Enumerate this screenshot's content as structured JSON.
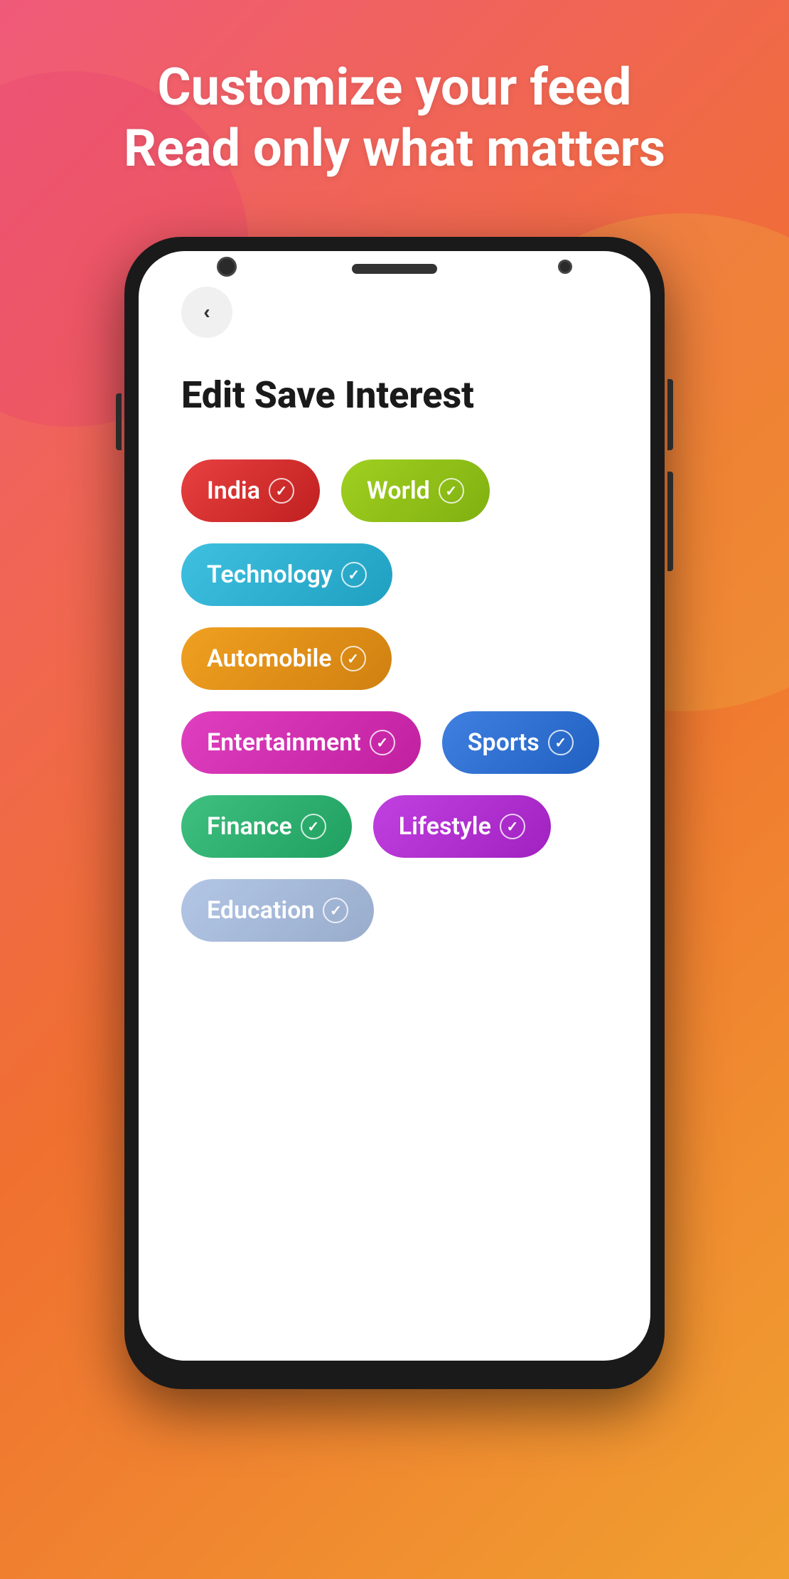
{
  "background": {
    "gradient_start": "#f05a7a",
    "gradient_end": "#f0a030"
  },
  "header": {
    "line1": "Customize your feed",
    "line2": "Read only what matters"
  },
  "screen": {
    "back_button_label": "‹",
    "page_title": "Edit Save Interest",
    "tags": [
      {
        "id": "india",
        "label": "India",
        "color_class": "tag-india",
        "checked": true
      },
      {
        "id": "world",
        "label": "World",
        "color_class": "tag-world",
        "checked": true
      },
      {
        "id": "technology",
        "label": "Technology",
        "color_class": "tag-technology",
        "checked": true
      },
      {
        "id": "automobile",
        "label": "Automobile",
        "color_class": "tag-automobile",
        "checked": true
      },
      {
        "id": "entertainment",
        "label": "Entertainment",
        "color_class": "tag-entertainment",
        "checked": true
      },
      {
        "id": "sports",
        "label": "Sports",
        "color_class": "tag-sports",
        "checked": true
      },
      {
        "id": "finance",
        "label": "Finance",
        "color_class": "tag-finance",
        "checked": true
      },
      {
        "id": "lifestyle",
        "label": "Lifestyle",
        "color_class": "tag-lifestyle",
        "checked": true
      },
      {
        "id": "education",
        "label": "Education",
        "color_class": "tag-education",
        "checked": true
      }
    ],
    "check_symbol": "✓"
  }
}
